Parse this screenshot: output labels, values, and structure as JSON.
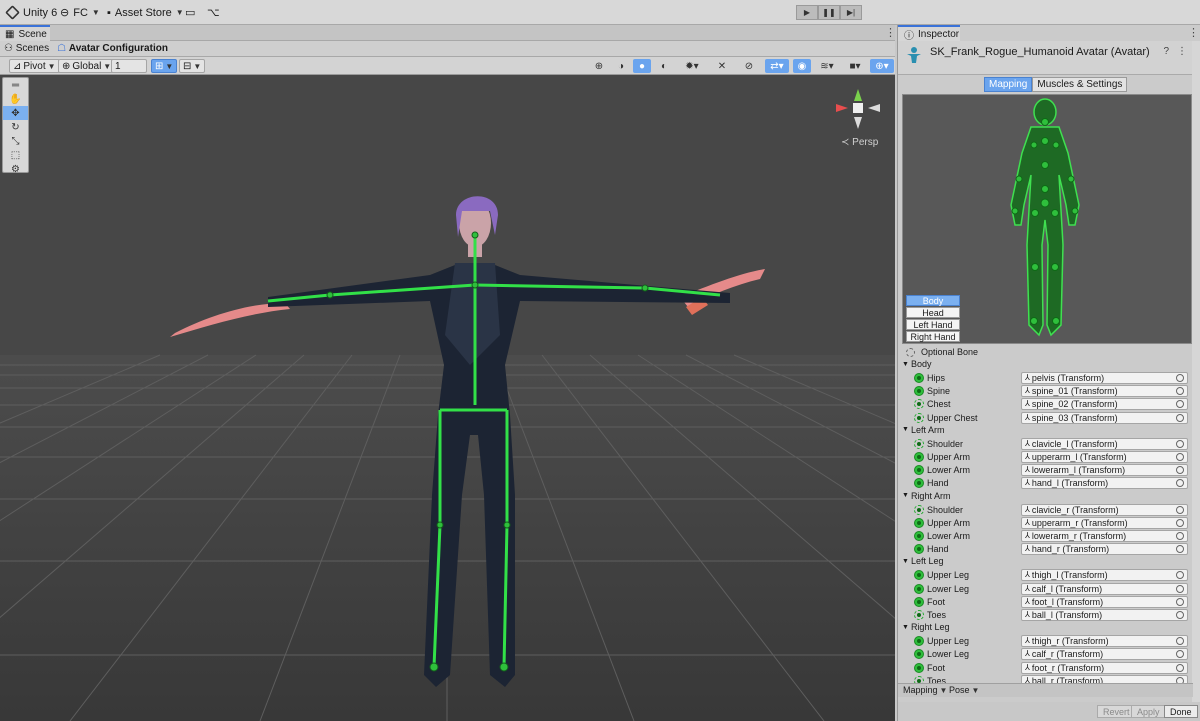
{
  "topbar": {
    "app": "Unity 6",
    "account": "FC",
    "store": "Asset Store"
  },
  "scene_tab": "Scene",
  "breadcrumb": {
    "root": "Scenes",
    "current": "Avatar Configuration"
  },
  "scene_toolbar": {
    "pivot": "Pivot",
    "space": "Global",
    "grid": "1"
  },
  "viewport": {
    "projection": "Persp"
  },
  "inspector": {
    "tab": "Inspector",
    "title": "SK_Frank_Rogue_Humanoid Avatar (Avatar)",
    "segments": [
      "Mapping",
      "Muscles & Settings"
    ],
    "body_parts": [
      "Body",
      "Head",
      "Left Hand",
      "Right Hand"
    ],
    "optional_bone": "Optional Bone",
    "groups": [
      {
        "name": "Body",
        "bones": [
          {
            "label": "Hips",
            "value": "pelvis (Transform)",
            "optional": false
          },
          {
            "label": "Spine",
            "value": "spine_01 (Transform)",
            "optional": false
          },
          {
            "label": "Chest",
            "value": "spine_02 (Transform)",
            "optional": true
          },
          {
            "label": "Upper Chest",
            "value": "spine_03 (Transform)",
            "optional": true
          }
        ]
      },
      {
        "name": "Left Arm",
        "bones": [
          {
            "label": "Shoulder",
            "value": "clavicle_l (Transform)",
            "optional": true
          },
          {
            "label": "Upper Arm",
            "value": "upperarm_l (Transform)",
            "optional": false
          },
          {
            "label": "Lower Arm",
            "value": "lowerarm_l (Transform)",
            "optional": false
          },
          {
            "label": "Hand",
            "value": "hand_l (Transform)",
            "optional": false
          }
        ]
      },
      {
        "name": "Right Arm",
        "bones": [
          {
            "label": "Shoulder",
            "value": "clavicle_r (Transform)",
            "optional": true
          },
          {
            "label": "Upper Arm",
            "value": "upperarm_r (Transform)",
            "optional": false
          },
          {
            "label": "Lower Arm",
            "value": "lowerarm_r (Transform)",
            "optional": false
          },
          {
            "label": "Hand",
            "value": "hand_r (Transform)",
            "optional": false
          }
        ]
      },
      {
        "name": "Left Leg",
        "bones": [
          {
            "label": "Upper Leg",
            "value": "thigh_l (Transform)",
            "optional": false
          },
          {
            "label": "Lower Leg",
            "value": "calf_l (Transform)",
            "optional": false
          },
          {
            "label": "Foot",
            "value": "foot_l (Transform)",
            "optional": false
          },
          {
            "label": "Toes",
            "value": "ball_l (Transform)",
            "optional": true
          }
        ]
      },
      {
        "name": "Right Leg",
        "bones": [
          {
            "label": "Upper Leg",
            "value": "thigh_r (Transform)",
            "optional": false
          },
          {
            "label": "Lower Leg",
            "value": "calf_r (Transform)",
            "optional": false
          },
          {
            "label": "Foot",
            "value": "foot_r (Transform)",
            "optional": false
          },
          {
            "label": "Toes",
            "value": "ball_r (Transform)",
            "optional": true
          }
        ]
      }
    ],
    "footer": {
      "mapping": "Mapping",
      "pose": "Pose"
    },
    "actions": {
      "revert": "Revert",
      "apply": "Apply",
      "done": "Done"
    }
  },
  "colors": {
    "bone_green": "#2fbf3c",
    "selection_blue": "#6aa4ee",
    "viewport_bg": "#444444"
  }
}
